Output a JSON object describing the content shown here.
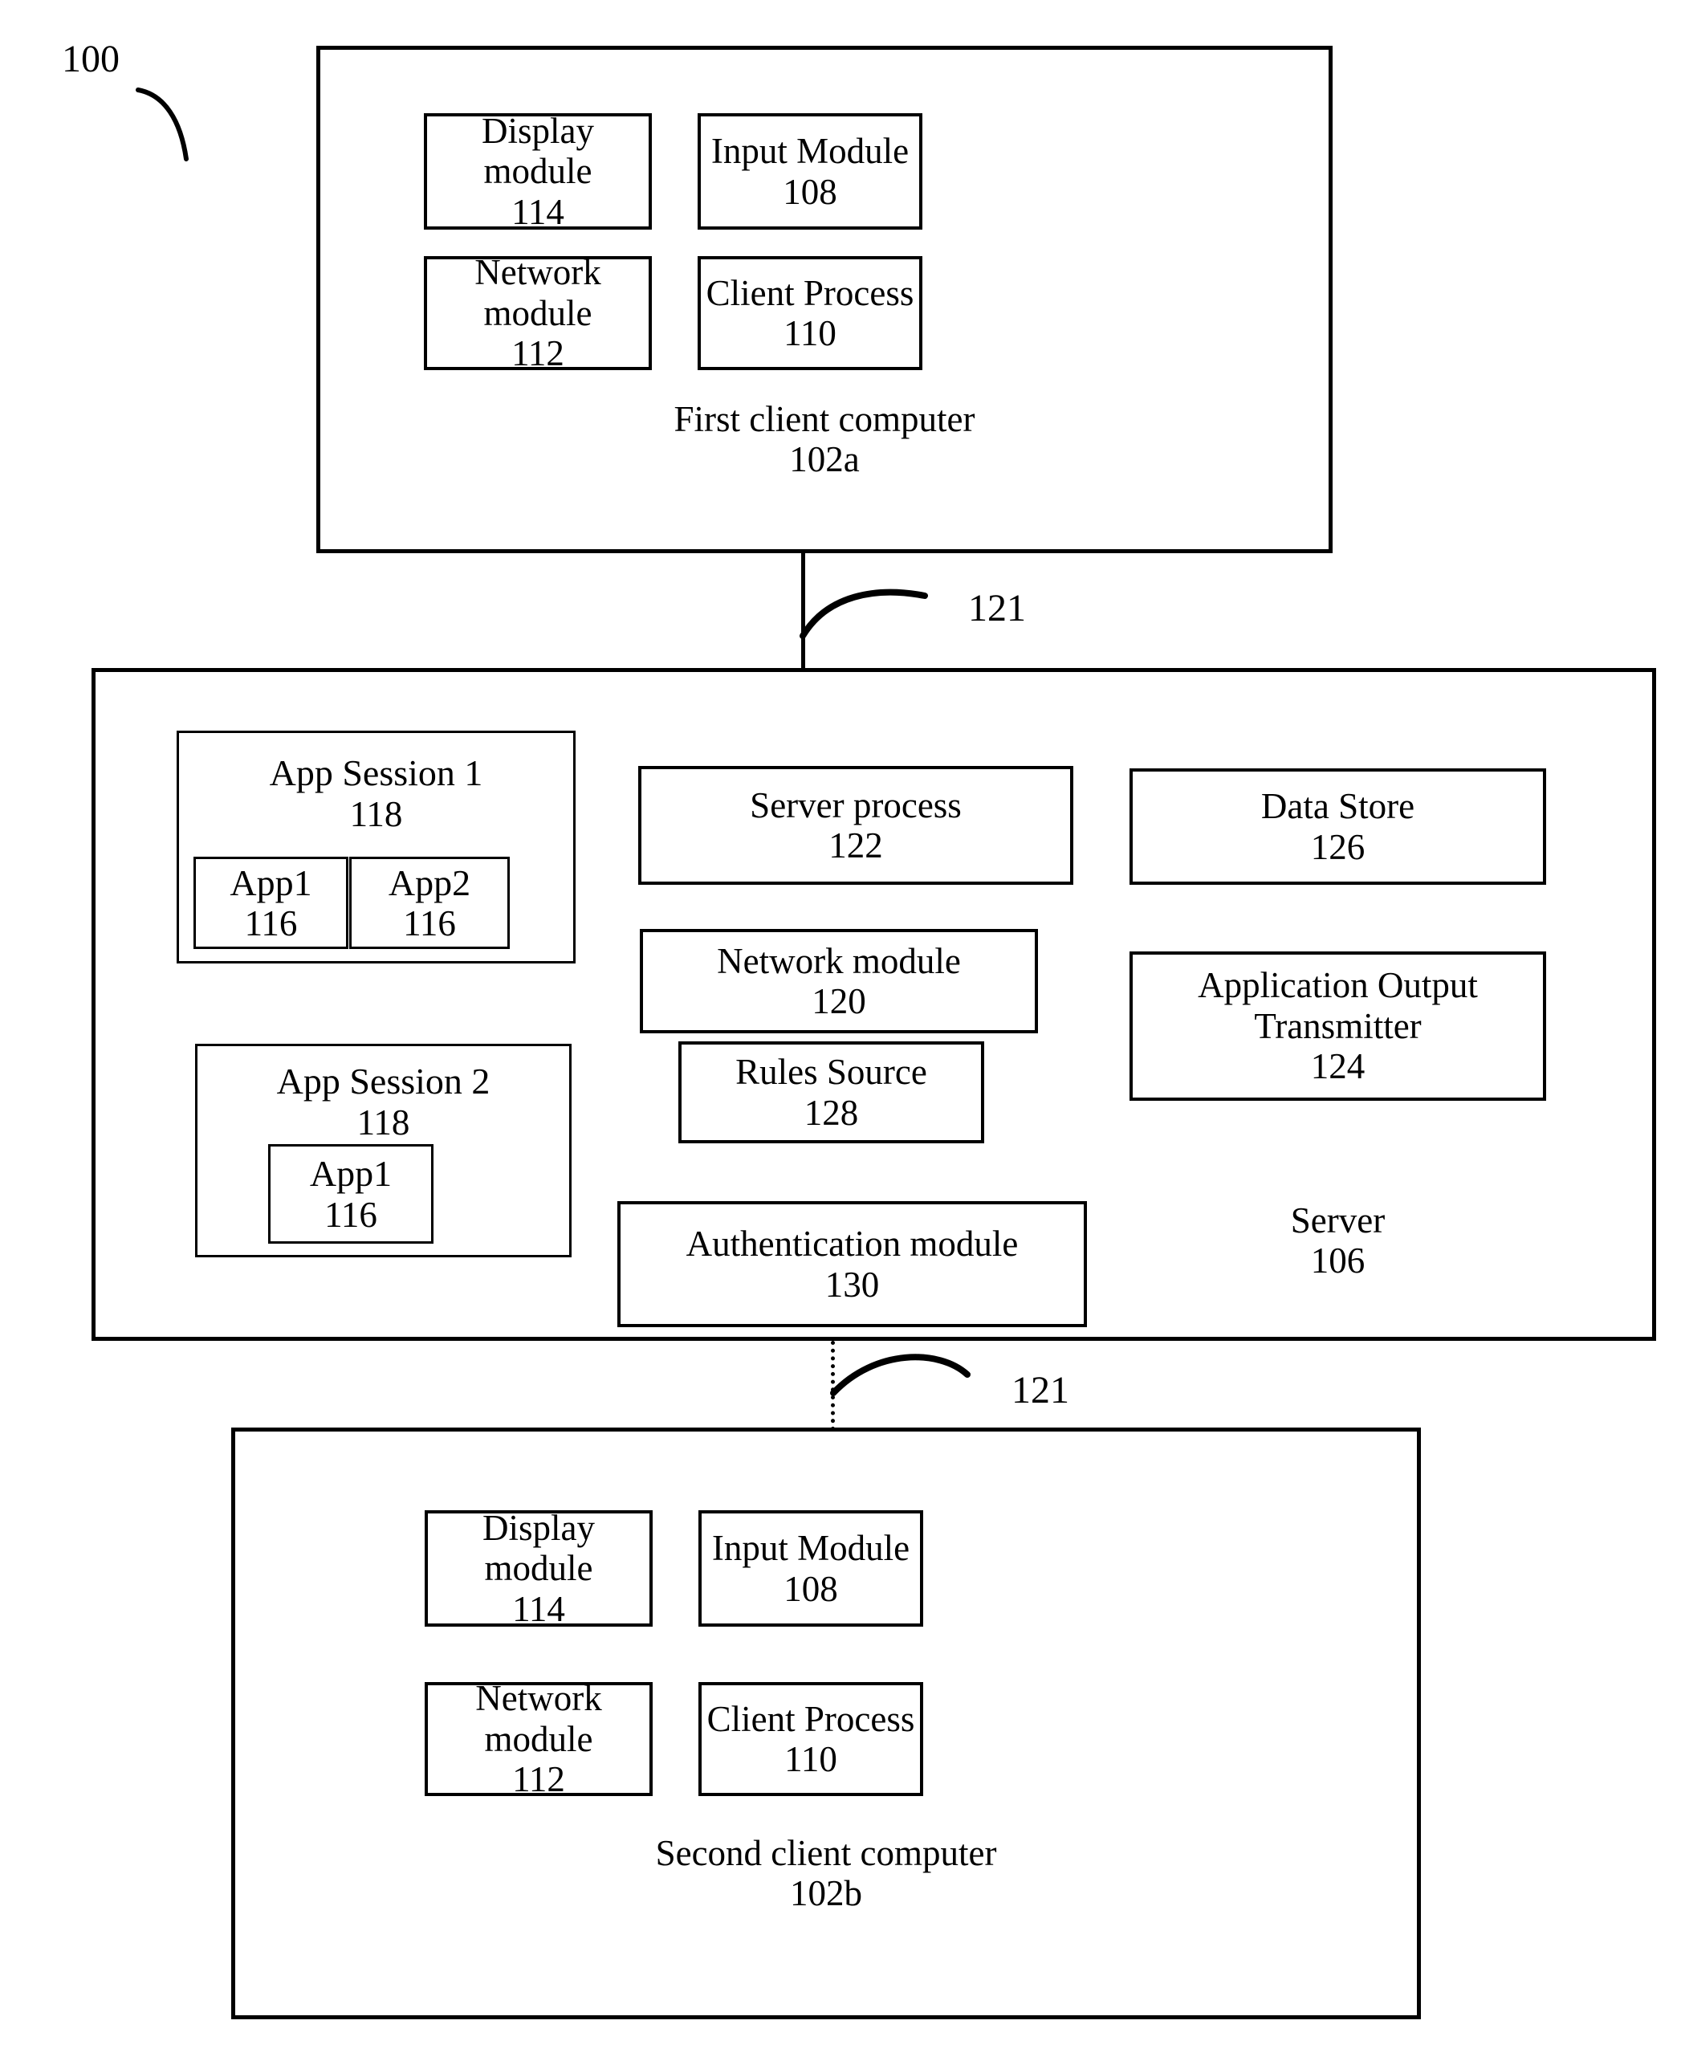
{
  "figure": {
    "reference_numeral": "100"
  },
  "first_client": {
    "title": "First client computer",
    "ref": "102a",
    "modules": [
      {
        "name": "Display module",
        "ref": "114"
      },
      {
        "name": "Input Module",
        "ref": "108"
      },
      {
        "name": "Network module",
        "ref": "112"
      },
      {
        "name": "Client Process",
        "ref": "110"
      }
    ]
  },
  "link_top": {
    "ref": "121"
  },
  "server": {
    "title": "Server",
    "ref": "106",
    "sessions": [
      {
        "name": "App Session 1",
        "ref": "118",
        "apps": [
          {
            "name": "App1",
            "ref": "116"
          },
          {
            "name": "App2",
            "ref": "116"
          }
        ]
      },
      {
        "name": "App Session 2",
        "ref": "118",
        "apps": [
          {
            "name": "App1",
            "ref": "116"
          }
        ]
      }
    ],
    "middle_modules": [
      {
        "name": "Server process",
        "ref": "122"
      },
      {
        "name": "Network module",
        "ref": "120"
      },
      {
        "name": "Rules Source",
        "ref": "128"
      },
      {
        "name": "Authentication module",
        "ref": "130"
      }
    ],
    "right_modules": [
      {
        "name": "Data Store",
        "ref": "126"
      },
      {
        "name": "Application Output",
        "name2": "Transmitter",
        "ref": "124"
      }
    ]
  },
  "link_bottom": {
    "ref": "121"
  },
  "second_client": {
    "title": "Second client computer",
    "ref": "102b",
    "modules": [
      {
        "name": "Display module",
        "ref": "114"
      },
      {
        "name": "Input Module",
        "ref": "108"
      },
      {
        "name": "Network module",
        "ref": "112"
      },
      {
        "name": "Client Process",
        "ref": "110"
      }
    ]
  },
  "colors": {
    "stroke": "#000000",
    "background": "#ffffff"
  }
}
